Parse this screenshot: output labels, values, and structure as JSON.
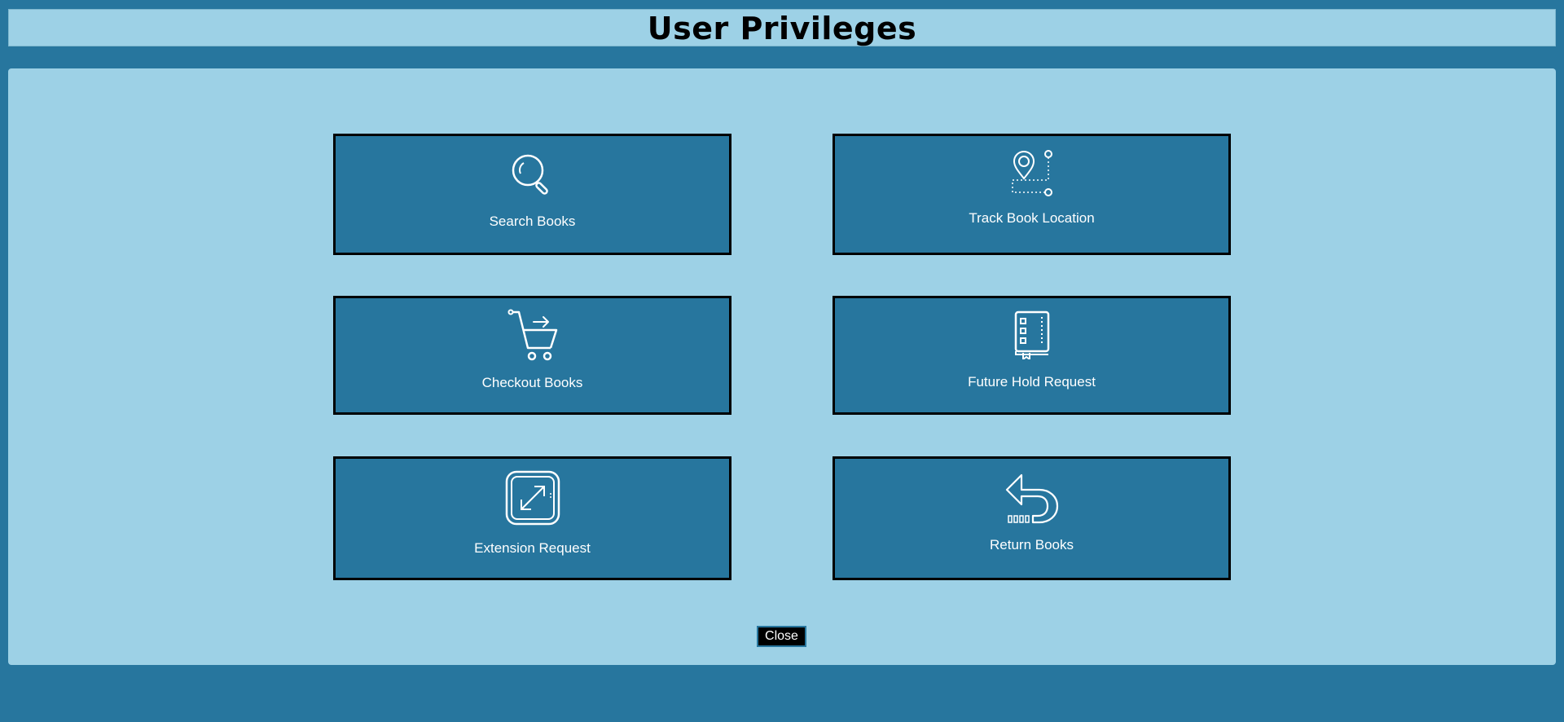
{
  "header": {
    "title": "User Privileges"
  },
  "tiles": [
    {
      "label": "Search Books",
      "icon": "search-icon"
    },
    {
      "label": "Track Book Location",
      "icon": "location-pin-icon"
    },
    {
      "label": "Checkout Books",
      "icon": "shopping-cart-icon"
    },
    {
      "label": "Future Hold Request",
      "icon": "book-icon"
    },
    {
      "label": "Extension Request",
      "icon": "expand-icon"
    },
    {
      "label": "Return Books",
      "icon": "return-arrow-icon"
    }
  ],
  "footer": {
    "close_label": "Close"
  },
  "colors": {
    "page_background": "#27769e",
    "panel_background": "#9dd1e6",
    "tile_background": "#27769e",
    "tile_border": "#000000",
    "close_button_background": "#000000"
  }
}
